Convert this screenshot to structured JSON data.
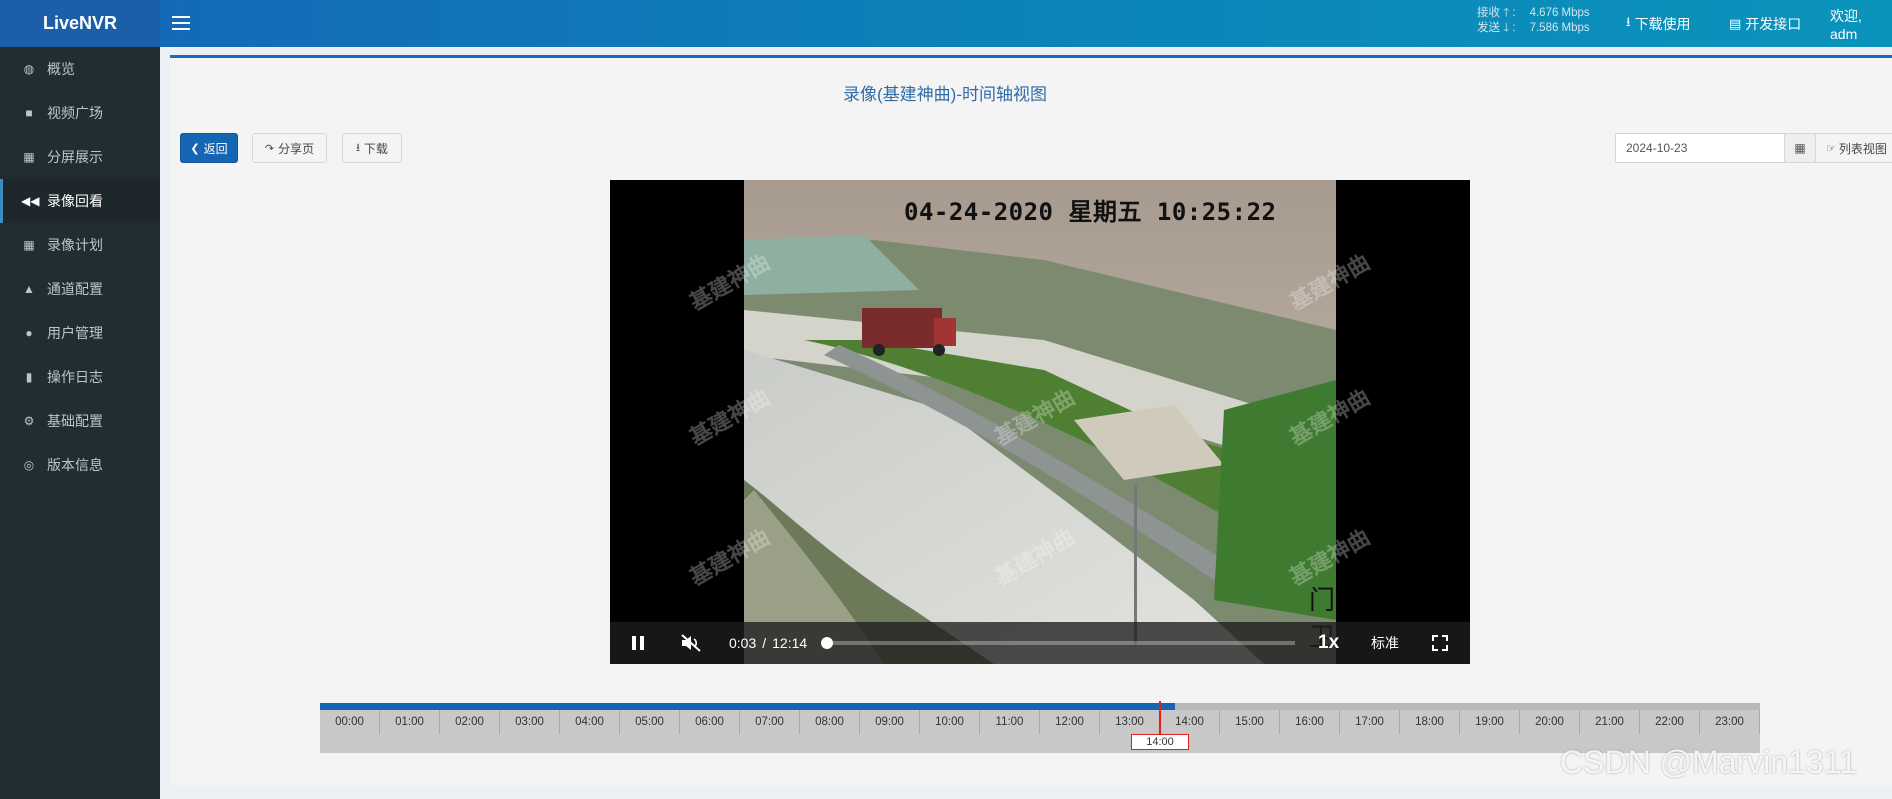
{
  "header": {
    "app_title": "LiveNVR",
    "net_recv_label": "接收 🡑 :",
    "net_recv_value": "4.676 Mbps",
    "net_send_label": "发送 🡓 :",
    "net_send_value": "7.586 Mbps",
    "download_label": "下载使用",
    "dev_api_label": "开发接口",
    "welcome_label": "欢迎, adm"
  },
  "sidebar": {
    "items": [
      {
        "label": "概览",
        "icon": "dashboard-icon"
      },
      {
        "label": "视频广场",
        "icon": "video-camera-icon"
      },
      {
        "label": "分屏展示",
        "icon": "grid-icon"
      },
      {
        "label": "录像回看",
        "icon": "rewind-icon"
      },
      {
        "label": "录像计划",
        "icon": "calendar-icon"
      },
      {
        "label": "通道配置",
        "icon": "road-icon"
      },
      {
        "label": "用户管理",
        "icon": "users-icon"
      },
      {
        "label": "操作日志",
        "icon": "file-icon"
      },
      {
        "label": "基础配置",
        "icon": "cogs-icon"
      },
      {
        "label": "版本信息",
        "icon": "lifebuoy-icon"
      }
    ],
    "active_index": 3
  },
  "main": {
    "title": "录像(基建神曲)-时间轴视图",
    "back_label": "返回",
    "share_label": "分享页",
    "download_label": "下载",
    "date_value": "2024-10-23",
    "list_view_label": "列表视图"
  },
  "player": {
    "osd_text": "04-24-2020 星期五 10:25:22",
    "gate_text": "门卫",
    "watermark_text": "基建神曲",
    "current_time": "0:03",
    "time_separator": "/",
    "duration": "12:14",
    "progress_fraction": 0.004,
    "speed_label": "1x",
    "quality_label": "标准"
  },
  "timeline": {
    "hours": [
      "00:00",
      "01:00",
      "02:00",
      "03:00",
      "04:00",
      "05:00",
      "06:00",
      "07:00",
      "08:00",
      "09:00",
      "10:00",
      "11:00",
      "12:00",
      "13:00",
      "14:00",
      "15:00",
      "16:00",
      "17:00",
      "18:00",
      "19:00",
      "20:00",
      "21:00",
      "22:00",
      "23:00"
    ],
    "recorded_until_hours": 14.25,
    "cursor_hours": 14.0,
    "cursor_label": "14:00"
  },
  "watermark": "CSDN @Marvin1311"
}
